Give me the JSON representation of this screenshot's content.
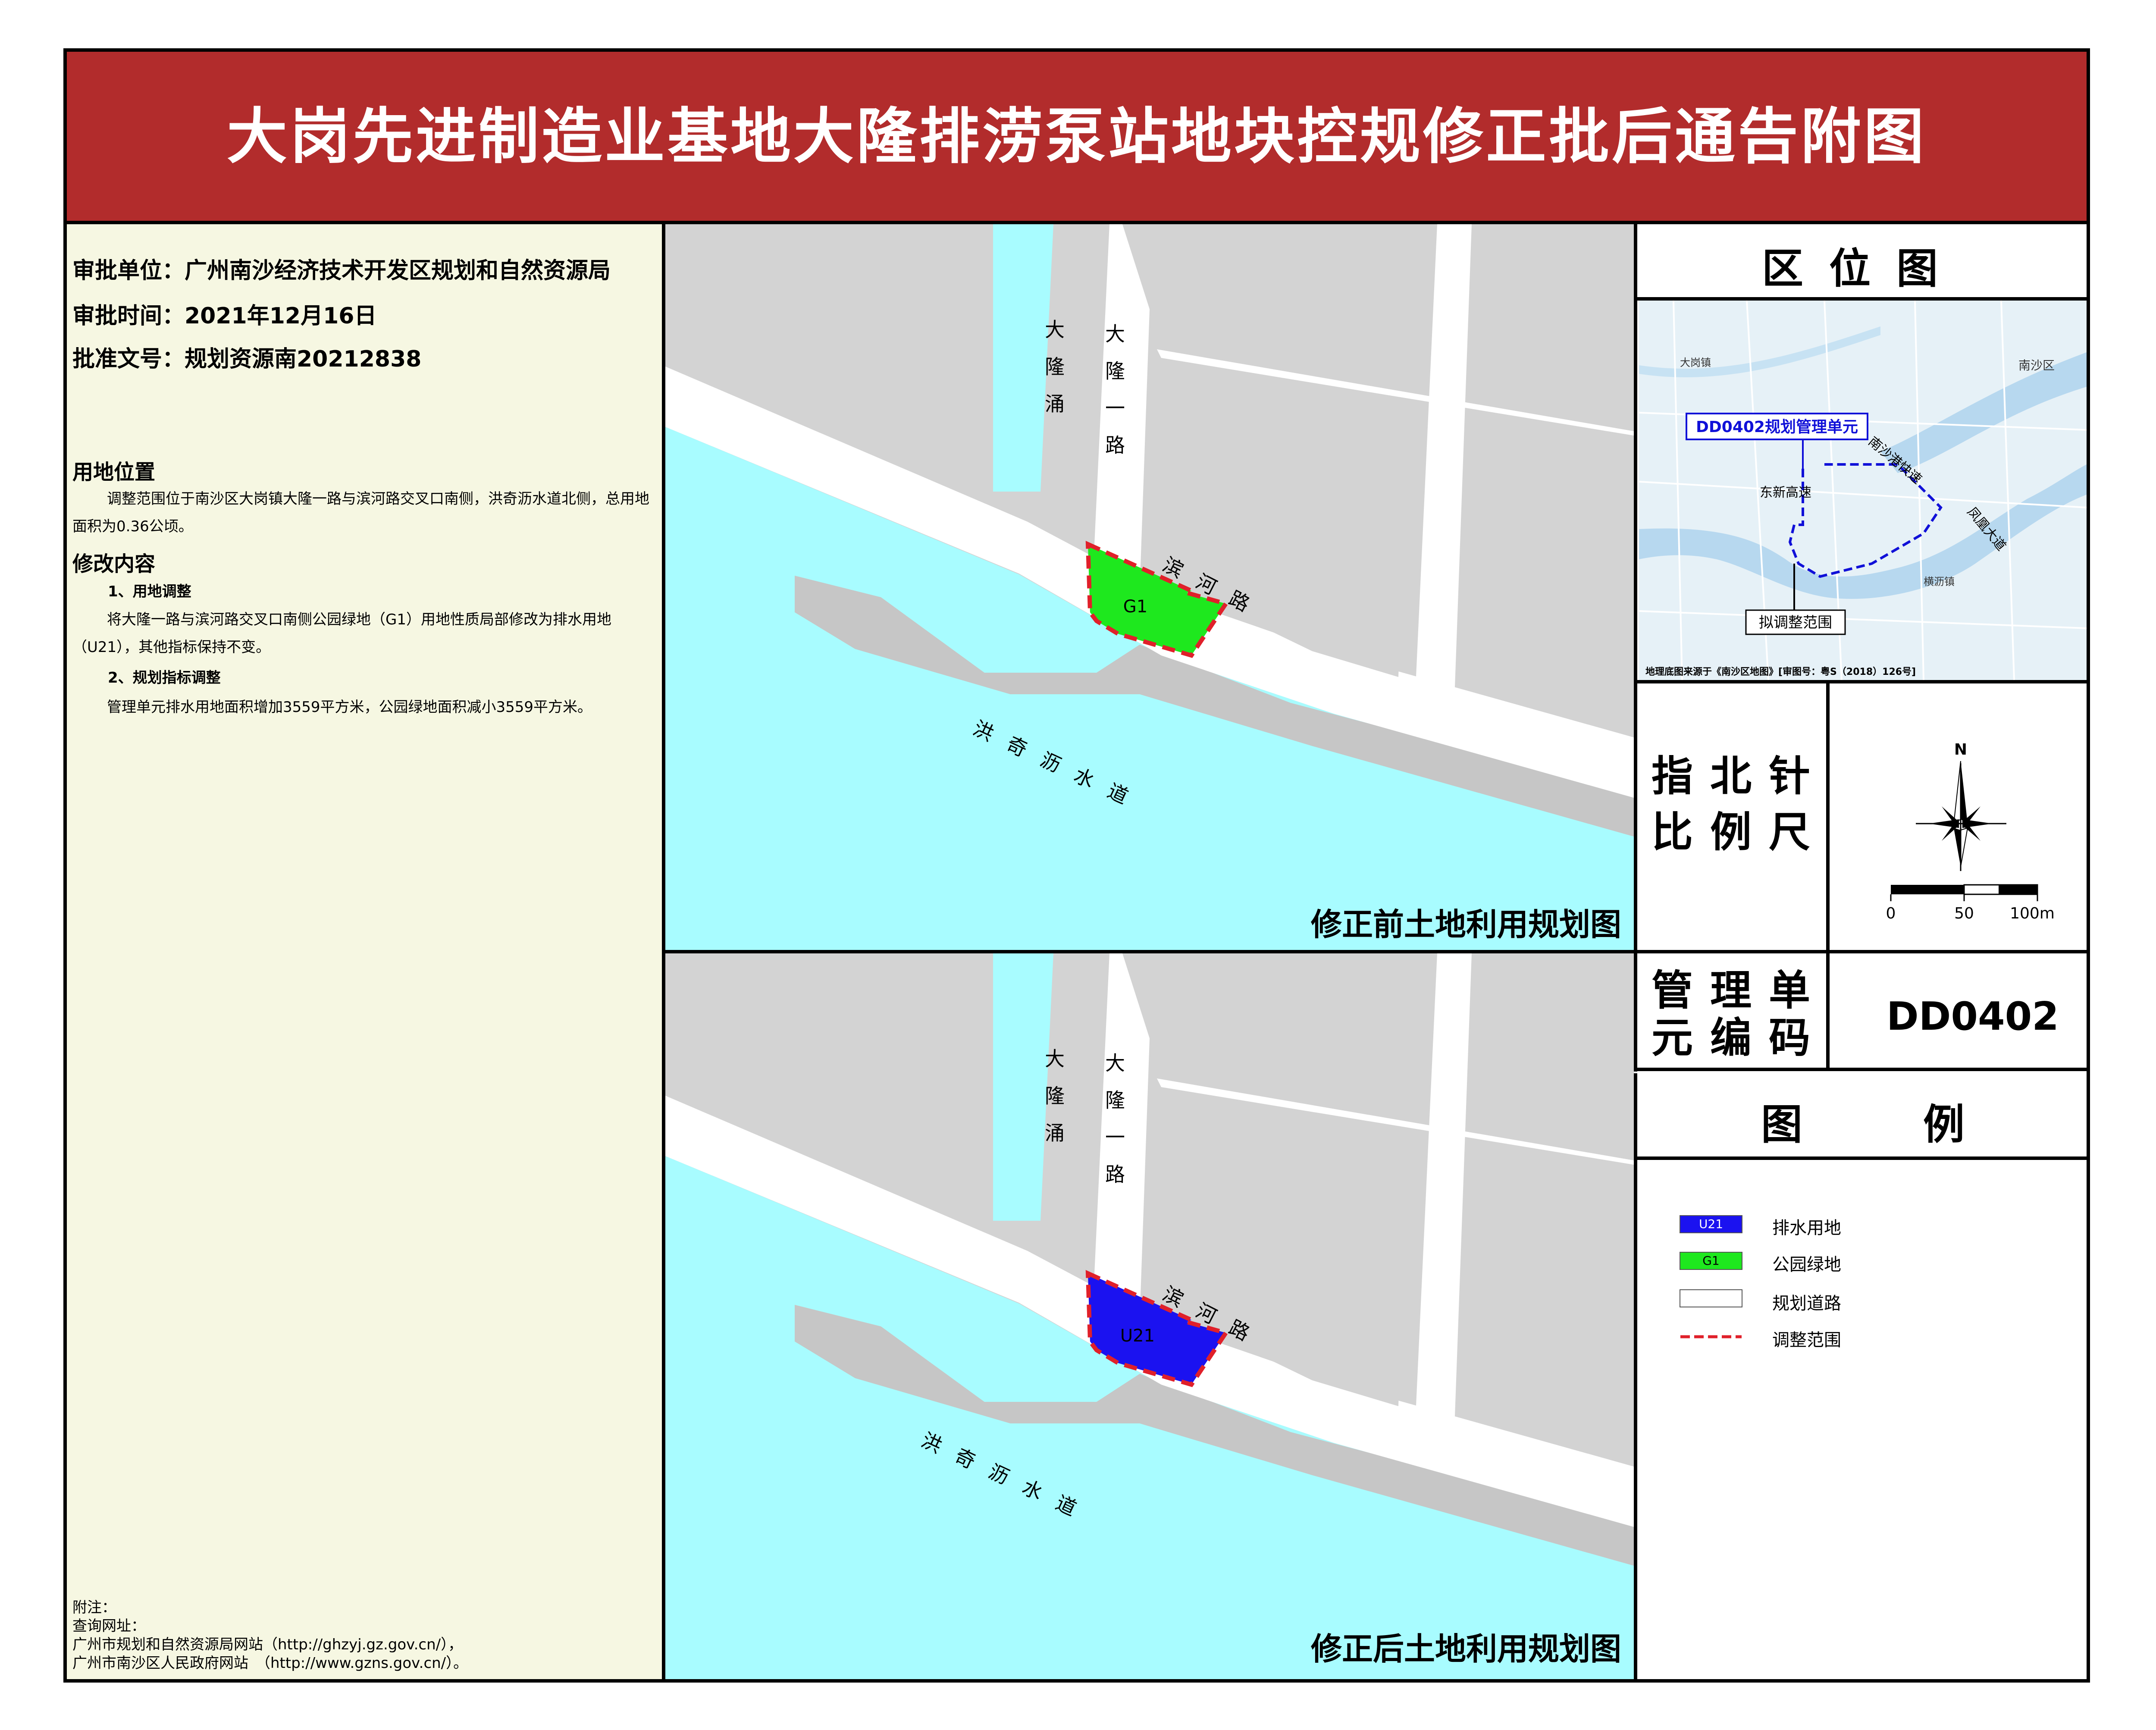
{
  "title": "大岗先进制造业基地大隆排涝泵站地块控规修正批后通告附图",
  "approval": {
    "unit": "审批单位：广州南沙经济技术开发区规划和自然资源局",
    "time": "审批时间：2021年12月16日",
    "doc_no": "批准文号：规划资源南20212838"
  },
  "location": {
    "heading": "用地位置",
    "body": "调整范围位于南沙区大岗镇大隆一路与滨河路交叉口南侧，洪奇沥水道北侧，总用地面积为0.36公顷。"
  },
  "modification": {
    "heading": "修改内容",
    "sub1": "1、用地调整",
    "body1": "将大隆一路与滨河路交叉口南侧公园绿地（G1）用地性质局部修改为排水用地（U21），其他指标保持不变。",
    "sub2": "2、规划指标调整",
    "body2": "管理单元排水用地面积增加3559平方米，公园绿地面积减小3559平方米。"
  },
  "notes": {
    "l1": "附注：",
    "l2": "查询网址：",
    "l3": "广州市规划和自然资源局网站（http://ghzyj.gz.gov.cn/），",
    "l4": "广州市南沙区人民政府网站　（http://www.gzns.gov.cn/）。"
  },
  "map_labels": {
    "canal": "大隆涌",
    "road1": "大隆一路",
    "road2": "滨河路",
    "waterway": "洪奇沥水道",
    "parcel_before": "G1",
    "parcel_after": "U21"
  },
  "map_before_title": "修正前土地利用规划图",
  "map_after_title": "修正后土地利用规划图",
  "location_map": {
    "title": "区位图",
    "unit_label": "DD0402规划管理单元",
    "scope_label": "拟调整范围",
    "source": "地理底图来源于《南沙区地图》[审图号：粤S（2018）126号]",
    "places": {
      "nansha": "南沙区",
      "dagang": "大岗镇",
      "dongxin": "东新高速",
      "nansha_gang": "南沙港快速",
      "fenghuang": "凤凰大道",
      "hengli": "横沥镇"
    }
  },
  "compass_scale": {
    "label1": "指北针",
    "label2": "比例尺",
    "north": "N",
    "ticks": [
      "0",
      "50",
      "100m"
    ]
  },
  "unit_code": {
    "label1": "管理单",
    "label2": "元编码",
    "value": "DD0402"
  },
  "legend": {
    "title": "图例",
    "items": [
      {
        "code": "U21",
        "label": "排水用地",
        "color": "#1b12f0"
      },
      {
        "code": "G1",
        "label": "公园绿地",
        "color": "#1ee81e"
      },
      {
        "code": "",
        "label": "规划道路",
        "color": "#ffffff"
      },
      {
        "code": "",
        "label": "调整范围",
        "color": "#e0202a"
      }
    ]
  },
  "colors": {
    "banner": "#b22c2c",
    "water": "#a8fcff",
    "block": "#d3d3d3",
    "road": "#ffffff",
    "boundary": "#e0202a"
  }
}
